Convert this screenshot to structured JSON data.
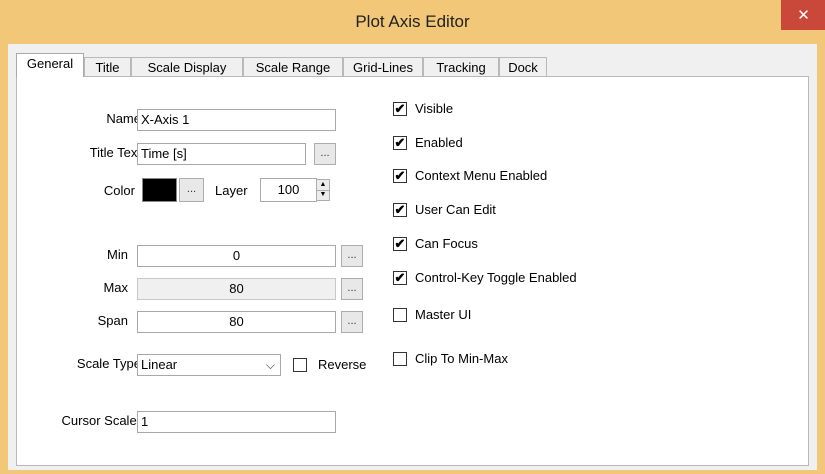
{
  "window": {
    "title": "Plot Axis Editor",
    "close_glyph": "✕"
  },
  "tabs": [
    "General",
    "Title",
    "Scale Display",
    "Scale Range",
    "Grid-Lines",
    "Tracking",
    "Dock"
  ],
  "form": {
    "name_label": "Name",
    "name_value": "X-Axis 1",
    "title_text_label": "Title Text",
    "title_text_value": "Time [s]",
    "color_label": "Color",
    "color_value": "#000000",
    "layer_label": "Layer",
    "layer_value": "100",
    "min_label": "Min",
    "min_value": "0",
    "max_label": "Max",
    "max_value": "80",
    "span_label": "Span",
    "span_value": "80",
    "scale_type_label": "Scale Type",
    "scale_type_value": "Linear",
    "reverse_label": "Reverse",
    "reverse_checked": false,
    "cursor_scaler_label": "Cursor Scaler",
    "cursor_scaler_value": "1",
    "ellipsis": "..."
  },
  "options": [
    {
      "label": "Visible",
      "checked": true
    },
    {
      "label": "Enabled",
      "checked": true
    },
    {
      "label": "Context Menu Enabled",
      "checked": true
    },
    {
      "label": "User Can Edit",
      "checked": true
    },
    {
      "label": "Can Focus",
      "checked": true
    },
    {
      "label": "Control-Key Toggle Enabled",
      "checked": true
    },
    {
      "label": "Master UI",
      "checked": false
    },
    {
      "label": "Clip To Min-Max",
      "checked": false
    }
  ],
  "check_glyph": "✔"
}
